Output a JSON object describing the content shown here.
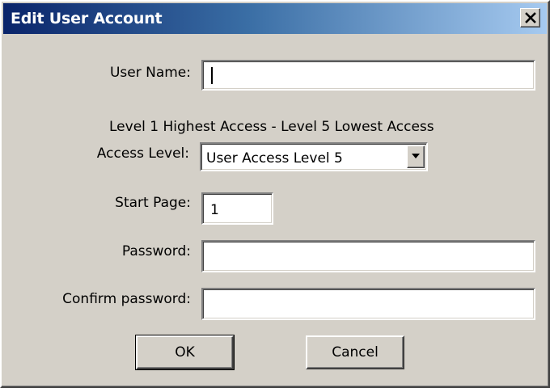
{
  "window": {
    "title": "Edit User Account"
  },
  "form": {
    "user_name_label": "User Name:",
    "user_name_value": "",
    "access_info": "Level 1 Highest Access - Level 5 Lowest Access",
    "access_level_label": "Access Level:",
    "access_level_value": "User Access Level 5",
    "start_page_label": "Start Page:",
    "start_page_value": "1",
    "password_label": "Password:",
    "password_value": "",
    "confirm_password_label": "Confirm password:",
    "confirm_password_value": ""
  },
  "buttons": {
    "ok_label": "OK",
    "cancel_label": "Cancel"
  },
  "icons": {
    "close": "close-icon",
    "dropdown": "chevron-down-icon"
  },
  "colors": {
    "titlebar_start": "#0a246a",
    "titlebar_end": "#a6caf0",
    "face": "#d4d0c8"
  }
}
